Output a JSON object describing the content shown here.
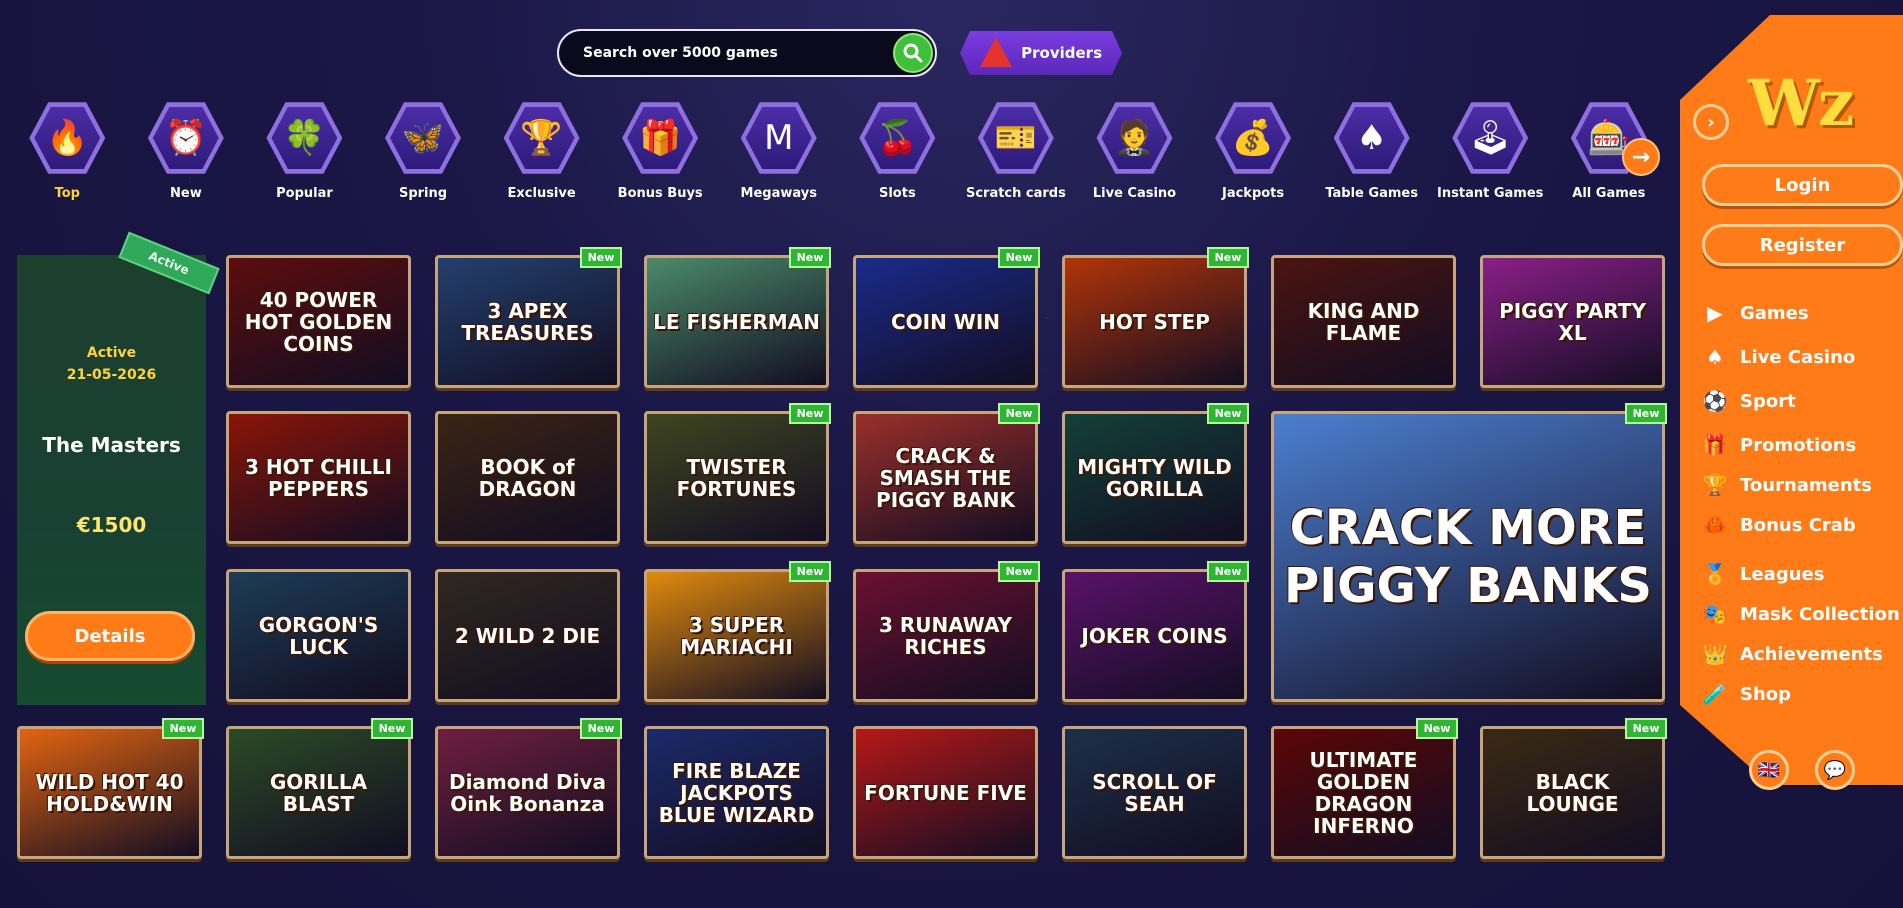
{
  "search": {
    "placeholder": "Search over 5000 games"
  },
  "providers": {
    "label": "Providers"
  },
  "categories": [
    {
      "label": "Top",
      "icon": "🔥"
    },
    {
      "label": "New",
      "icon": "⏰"
    },
    {
      "label": "Popular",
      "icon": "🍀"
    },
    {
      "label": "Spring",
      "icon": "🦋"
    },
    {
      "label": "Exclusive",
      "icon": "🏆"
    },
    {
      "label": "Bonus Buys",
      "icon": "🎁"
    },
    {
      "label": "Megaways",
      "icon": "M"
    },
    {
      "label": "Slots",
      "icon": "🍒"
    },
    {
      "label": "Scratch cards",
      "icon": "🎫"
    },
    {
      "label": "Live Casino",
      "icon": "🤵"
    },
    {
      "label": "Jackpots",
      "icon": "💰"
    },
    {
      "label": "Table Games",
      "icon": "♠"
    },
    {
      "label": "Instant Games",
      "icon": "🕹"
    },
    {
      "label": "All Games",
      "icon": "🎰"
    }
  ],
  "category_arrow": "→",
  "tournament": {
    "ribbon": "Active",
    "status": "Active",
    "date": "21-05-2026",
    "name": "The Masters",
    "prize": "€1500",
    "details_label": "Details"
  },
  "badge_new": "New",
  "games": [
    {
      "title": "40 POWER HOT GOLDEN COINS",
      "new": false,
      "bg": "#5c0d0d"
    },
    {
      "title": "3 APEX TREASURES",
      "new": true,
      "bg": "#23406e"
    },
    {
      "title": "LE FISHERMAN",
      "new": true,
      "bg": "#4b8a6a"
    },
    {
      "title": "COIN WIN",
      "new": true,
      "bg": "#1a2b8a"
    },
    {
      "title": "HOT STEP",
      "new": true,
      "bg": "#b23408"
    },
    {
      "title": "KING AND FLAME",
      "new": false,
      "bg": "#4a1410"
    },
    {
      "title": "PIGGY PARTY XL",
      "new": false,
      "bg": "#8a1f88"
    },
    {
      "title": "3 HOT CHILLI PEPPERS",
      "new": false,
      "bg": "#8a1408"
    },
    {
      "title": "BOOK of DRAGON",
      "new": false,
      "bg": "#3a2414"
    },
    {
      "title": "TWISTER FORTUNES",
      "new": true,
      "bg": "#3f4520"
    },
    {
      "title": "CRACK & SMASH THE PIGGY BANK",
      "new": true,
      "bg": "#9b2f2a"
    },
    {
      "title": "MIGHTY WILD GORILLA",
      "new": true,
      "bg": "#134038"
    },
    {
      "title": "CRACK MORE PIGGY BANKS",
      "new": true,
      "bg": "#4c7fd0"
    },
    {
      "title": "GORGON'S LUCK",
      "new": false,
      "bg": "#1d3c55"
    },
    {
      "title": "2 WILD 2 DIE",
      "new": false,
      "bg": "#302820"
    },
    {
      "title": "3 SUPER MARIACHI",
      "new": true,
      "bg": "#e08a0c"
    },
    {
      "title": "3 RUNAWAY RICHES",
      "new": true,
      "bg": "#6a1030"
    },
    {
      "title": "JOKER COINS",
      "new": true,
      "bg": "#5a1268"
    },
    {
      "title": "WILD HOT 40 HOLD&WIN",
      "new": true,
      "bg": "#e26410"
    },
    {
      "title": "GORILLA BLAST",
      "new": true,
      "bg": "#2b4a26"
    },
    {
      "title": "Diamond Diva Oink Bonanza",
      "new": true,
      "bg": "#6e1f3f"
    },
    {
      "title": "FIRE BLAZE JACKPOTS BLUE WIZARD",
      "new": false,
      "bg": "#1c2a6a"
    },
    {
      "title": "FORTUNE FIVE",
      "new": false,
      "bg": "#b61818"
    },
    {
      "title": "SCROLL OF SEAH",
      "new": false,
      "bg": "#1c3048"
    },
    {
      "title": "ULTIMATE GOLDEN DRAGON INFERNO",
      "new": true,
      "bg": "#5b0606"
    },
    {
      "title": "BLACK LOUNGE",
      "new": true,
      "bg": "#3a2a14"
    }
  ],
  "sidebar": {
    "logo": "Wz",
    "collapse_icon": "›",
    "login_label": "Login",
    "register_label": "Register",
    "menu": [
      {
        "label": "Games",
        "icon": "▶"
      },
      {
        "label": "Live Casino",
        "icon": "♠"
      },
      {
        "label": "Sport",
        "icon": "⚽"
      },
      {
        "label": "Promotions",
        "icon": "🎁"
      },
      {
        "label": "Tournaments",
        "icon": "🏆"
      },
      {
        "label": "Bonus Crab",
        "icon": "🦀"
      },
      {
        "label": "Leagues",
        "icon": "🏅"
      },
      {
        "label": "Mask Collection",
        "icon": "🎭"
      },
      {
        "label": "Achievements",
        "icon": "👑"
      },
      {
        "label": "Shop",
        "icon": "🧪"
      }
    ],
    "language_icon": "🇬🇧",
    "chat_icon": "💬"
  }
}
